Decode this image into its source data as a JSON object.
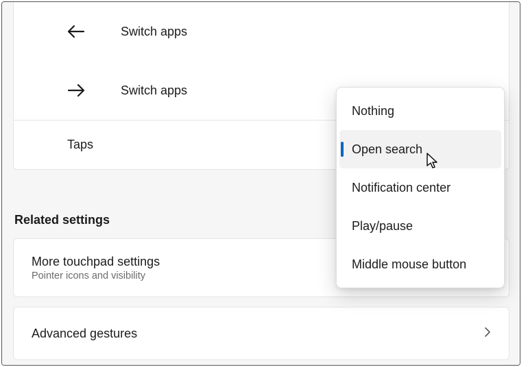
{
  "gestures": {
    "swipe_left": {
      "label": "Switch apps"
    },
    "swipe_right": {
      "label": "Switch apps"
    },
    "taps": {
      "label": "Taps"
    }
  },
  "related_heading": "Related settings",
  "cards": {
    "more_touchpad": {
      "title": "More touchpad settings",
      "subtitle": "Pointer icons and visibility"
    },
    "advanced_gestures": {
      "title": "Advanced gestures"
    }
  },
  "dropdown": {
    "items": [
      {
        "label": "Nothing"
      },
      {
        "label": "Open search"
      },
      {
        "label": "Notification center"
      },
      {
        "label": "Play/pause"
      },
      {
        "label": "Middle mouse button"
      }
    ],
    "selected_index": 1
  }
}
